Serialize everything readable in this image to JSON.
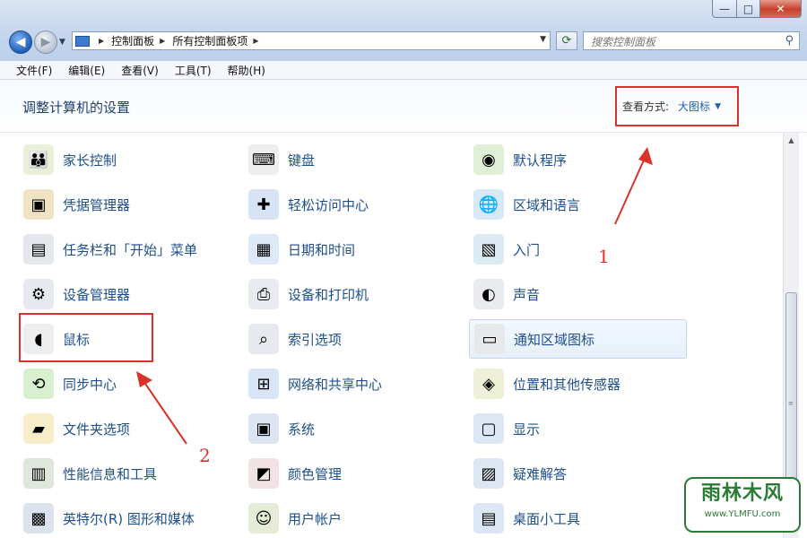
{
  "window": {
    "controls": {
      "minimize": "—",
      "maximize": "□",
      "close": "✕"
    }
  },
  "nav": {
    "back": "◀",
    "forward": "▶",
    "breadcrumb": [
      "控制面板",
      "所有控制面板项"
    ],
    "search_placeholder": "搜索控制面板"
  },
  "menu": [
    "文件(F)",
    "编辑(E)",
    "查看(V)",
    "工具(T)",
    "帮助(H)"
  ],
  "header": {
    "title": "调整计算机的设置",
    "view_by_label": "查看方式:",
    "view_by_value": "大图标"
  },
  "items": [
    {
      "label": "家长控制",
      "icon": "parental-controls-icon"
    },
    {
      "label": "键盘",
      "icon": "keyboard-icon"
    },
    {
      "label": "默认程序",
      "icon": "default-programs-icon"
    },
    {
      "label": "凭据管理器",
      "icon": "credential-manager-icon"
    },
    {
      "label": "轻松访问中心",
      "icon": "ease-of-access-icon"
    },
    {
      "label": "区域和语言",
      "icon": "region-language-icon"
    },
    {
      "label": "任务栏和「开始」菜单",
      "icon": "taskbar-icon"
    },
    {
      "label": "日期和时间",
      "icon": "date-time-icon"
    },
    {
      "label": "入门",
      "icon": "getting-started-icon"
    },
    {
      "label": "设备管理器",
      "icon": "device-manager-icon"
    },
    {
      "label": "设备和打印机",
      "icon": "devices-printers-icon"
    },
    {
      "label": "声音",
      "icon": "sound-icon"
    },
    {
      "label": "鼠标",
      "icon": "mouse-icon"
    },
    {
      "label": "索引选项",
      "icon": "indexing-icon"
    },
    {
      "label": "通知区域图标",
      "icon": "notification-area-icon"
    },
    {
      "label": "同步中心",
      "icon": "sync-center-icon"
    },
    {
      "label": "网络和共享中心",
      "icon": "network-sharing-icon"
    },
    {
      "label": "位置和其他传感器",
      "icon": "location-sensors-icon"
    },
    {
      "label": "文件夹选项",
      "icon": "folder-options-icon"
    },
    {
      "label": "系统",
      "icon": "system-icon"
    },
    {
      "label": "显示",
      "icon": "display-icon"
    },
    {
      "label": "性能信息和工具",
      "icon": "performance-icon"
    },
    {
      "label": "颜色管理",
      "icon": "color-management-icon"
    },
    {
      "label": "疑难解答",
      "icon": "troubleshooting-icon"
    },
    {
      "label": "英特尔(R) 图形和媒体",
      "icon": "intel-graphics-icon"
    },
    {
      "label": "用户帐户",
      "icon": "user-accounts-icon"
    },
    {
      "label": "桌面小工具",
      "icon": "gadgets-icon"
    }
  ],
  "annotations": {
    "one": "1",
    "two": "2"
  },
  "watermark": {
    "main": "雨林木风",
    "sub": "www.YLMFU.com"
  },
  "colors": {
    "accent": "#1d4f8c",
    "highlight": "#d9322b"
  }
}
